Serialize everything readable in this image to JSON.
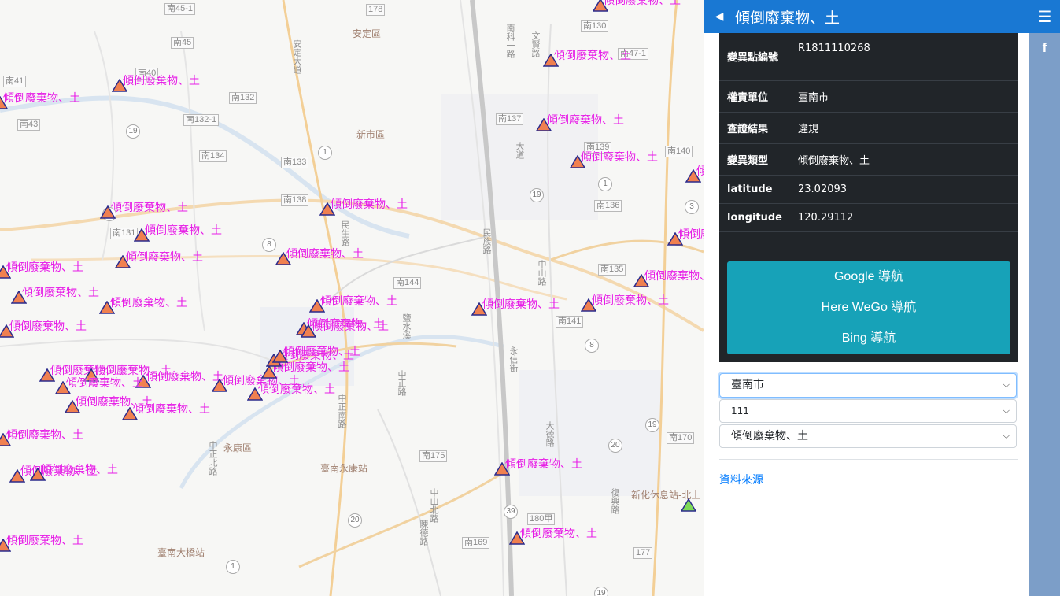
{
  "panel": {
    "title": "傾倒廢棄物、土",
    "collapse_icon": "caret-left-icon",
    "info": [
      {
        "key": "變異點編號",
        "value": "R1811110268"
      },
      {
        "key": "權責單位",
        "value": "臺南市"
      },
      {
        "key": "查證結果",
        "value": "違規"
      },
      {
        "key": "變異類型",
        "value": "傾倒廢棄物、土"
      },
      {
        "key": "latitude",
        "value": "23.02093"
      },
      {
        "key": "longitude",
        "value": "120.29112"
      }
    ],
    "nav_buttons": [
      "Google 導航",
      "Here WeGo 導航",
      "Bing 導航"
    ],
    "filters": {
      "city": "臺南市",
      "year": "111",
      "type": "傾倒廢棄物、土"
    },
    "data_source_link": "資料來源"
  },
  "share": {
    "menu_icon": "hamburger-menu-icon",
    "facebook_label": "f"
  },
  "map": {
    "marker_label": "傾倒廢棄物、土",
    "marker_color": "#f08050",
    "marker_outline": "#2b2b8c",
    "highlight_marker_color": "#7ed957",
    "label_color": "#e51ae5",
    "districts": [
      "安定區",
      "新市區",
      "永康區"
    ],
    "stations": [
      "臺南永康站",
      "臺南大橋站",
      "新化休息站-北上"
    ],
    "road_numbers": [
      "南45-1",
      "178",
      "南130",
      "南45",
      "南47-1",
      "南41",
      "南40",
      "南132",
      "南132-1",
      "南137",
      "南43",
      "南134",
      "南133",
      "南139",
      "南140",
      "南131",
      "南136",
      "南138",
      "南135",
      "南144",
      "南141",
      "南175",
      "南170",
      "180甲",
      "南169",
      "177"
    ],
    "road_names": [
      "安定大道",
      "南科一路",
      "文賢路",
      "大道",
      "中山路",
      "中正路",
      "民族路",
      "永信街",
      "中正南路",
      "中正北路",
      "大德路",
      "中山北路",
      "復興路",
      "鹽水溪",
      "陳德路",
      "民生路"
    ],
    "highway_numbers": [
      "19",
      "1",
      "8",
      "3",
      "20",
      "39"
    ]
  }
}
